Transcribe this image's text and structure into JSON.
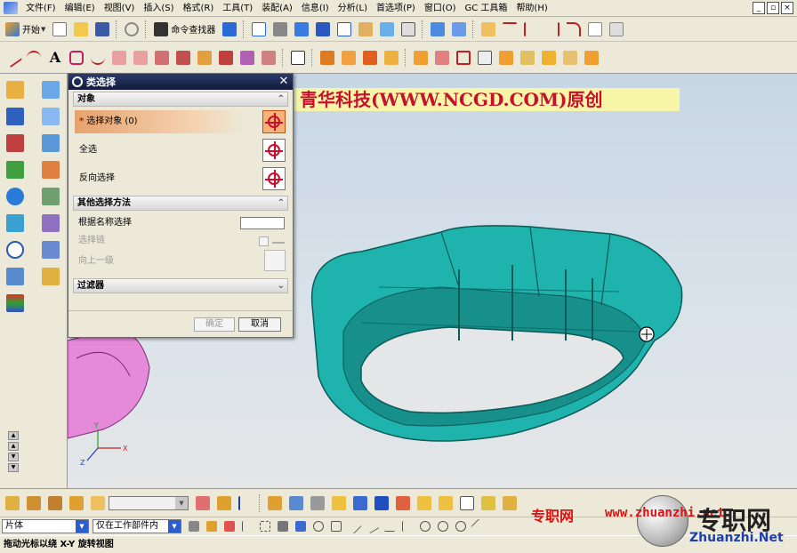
{
  "menu": [
    "文件(F)",
    "编辑(E)",
    "视图(V)",
    "插入(S)",
    "格式(R)",
    "工具(T)",
    "装配(A)",
    "信息(I)",
    "分析(L)",
    "首选项(P)",
    "窗口(O)",
    "GC 工具箱",
    "帮助(H)"
  ],
  "toolbar": {
    "start_label": "开始",
    "command_finder_label": "命令查找器"
  },
  "banner_text": "青华科技(WWW.NCGD.COM)原创",
  "dialog": {
    "title": "类选择",
    "section_object": "对象",
    "select_object_label": "选择对象 (0)",
    "select_all_label": "全选",
    "invert_selection_label": "反向选择",
    "section_other": "其他选择方法",
    "select_by_name_label": "根据名称选择",
    "select_chain_label": "选择链",
    "up_one_level_label": "向上一级",
    "section_filter": "过滤器",
    "ok_label": "确定",
    "cancel_label": "取消"
  },
  "bottom": {
    "filter_type_value": "片体",
    "scope_value": "仅在工作部件内"
  },
  "status_text": "拖动光标以绕 X-Y 旋转视图",
  "watermark": {
    "brand_cn": "专职网",
    "url": "www.zhuanzhi.net",
    "brand_big": "专职网",
    "site": "Zhuanzhi.Net"
  },
  "colors": {
    "part_teal": "#1fb3ad",
    "part_pink": "#e58ad8",
    "accent_orange": "#f7b377",
    "title_bar": "#1a2550"
  }
}
